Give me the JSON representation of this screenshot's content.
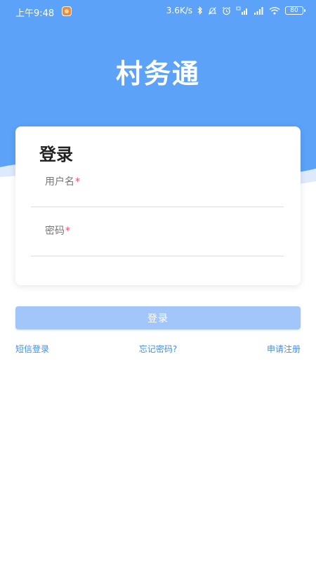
{
  "status_bar": {
    "time": "上午9:48",
    "network_speed": "3.6K/s",
    "battery": "80",
    "icons": [
      "app-notification-icon",
      "bluetooth-icon",
      "mute-bell-icon",
      "alarm-icon",
      "hd-signal-icon",
      "signal-icon",
      "wifi-icon",
      "battery-icon"
    ]
  },
  "app": {
    "title": "村务通"
  },
  "login_card": {
    "title": "登录",
    "username": {
      "label": "用户名",
      "required_mark": "*",
      "value": ""
    },
    "password": {
      "label": "密码",
      "required_mark": "*",
      "value": ""
    }
  },
  "login_button": {
    "label": "登录"
  },
  "links": {
    "sms_login": "短信登录",
    "forgot_password": "忘记密码?",
    "register": "申请注册"
  },
  "colors": {
    "header_blue": "#5ba2f8",
    "wave_blue": "#e8f2fd",
    "button_blue": "#a2c5fa",
    "link_blue": "#3f8ee8",
    "required_red": "#e0566b"
  }
}
